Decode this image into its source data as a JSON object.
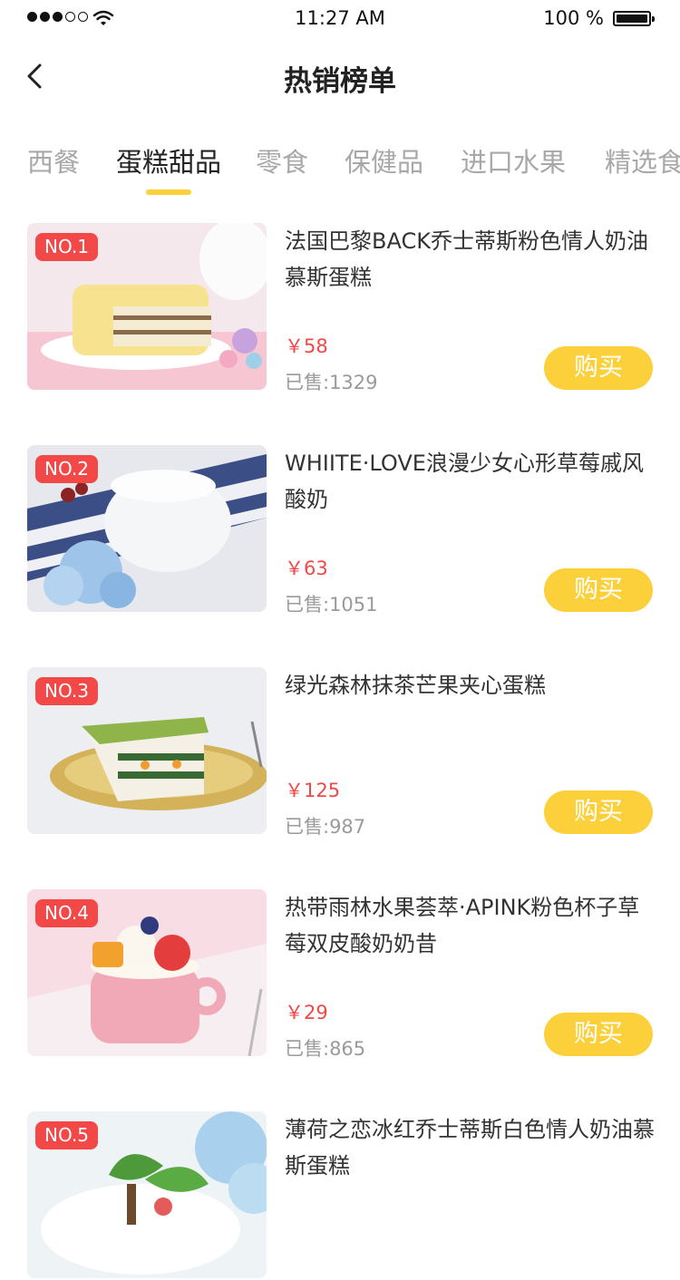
{
  "status_bar": {
    "time": "11:27 AM",
    "battery": "100 %"
  },
  "header": {
    "title": "热销榜单"
  },
  "tabs": [
    {
      "label": "西餐",
      "active": false
    },
    {
      "label": "蛋糕甜品",
      "active": true
    },
    {
      "label": "零食",
      "active": false
    },
    {
      "label": "保健品",
      "active": false
    },
    {
      "label": "进口水果",
      "active": false
    },
    {
      "label": "精选食",
      "active": false
    }
  ],
  "products": [
    {
      "rank": "NO.1",
      "name": "法国巴黎BACK乔士蒂斯粉色情人奶油慕斯蛋糕",
      "price": "￥58",
      "sold": "已售:1329",
      "buy_label": "购买"
    },
    {
      "rank": "NO.2",
      "name": "WHIITE·LOVE浪漫少女心形草莓戚风酸奶",
      "price": "￥63",
      "sold": "已售:1051",
      "buy_label": "购买"
    },
    {
      "rank": "NO.3",
      "name": "绿光森林抹茶芒果夹心蛋糕",
      "price": "￥125",
      "sold": "已售:987",
      "buy_label": "购买"
    },
    {
      "rank": "NO.4",
      "name": "热带雨林水果荟萃·APINK粉色杯子草莓双皮酸奶奶昔",
      "price": "￥29",
      "sold": "已售:865",
      "buy_label": "购买"
    },
    {
      "rank": "NO.5",
      "name": "薄荷之恋冰红乔士蒂斯白色情人奶油慕斯蛋糕",
      "price": "",
      "sold": "",
      "buy_label": ""
    }
  ],
  "colors": {
    "accent": "#fbd03a",
    "price": "#f24848",
    "badge": "#f24848"
  }
}
